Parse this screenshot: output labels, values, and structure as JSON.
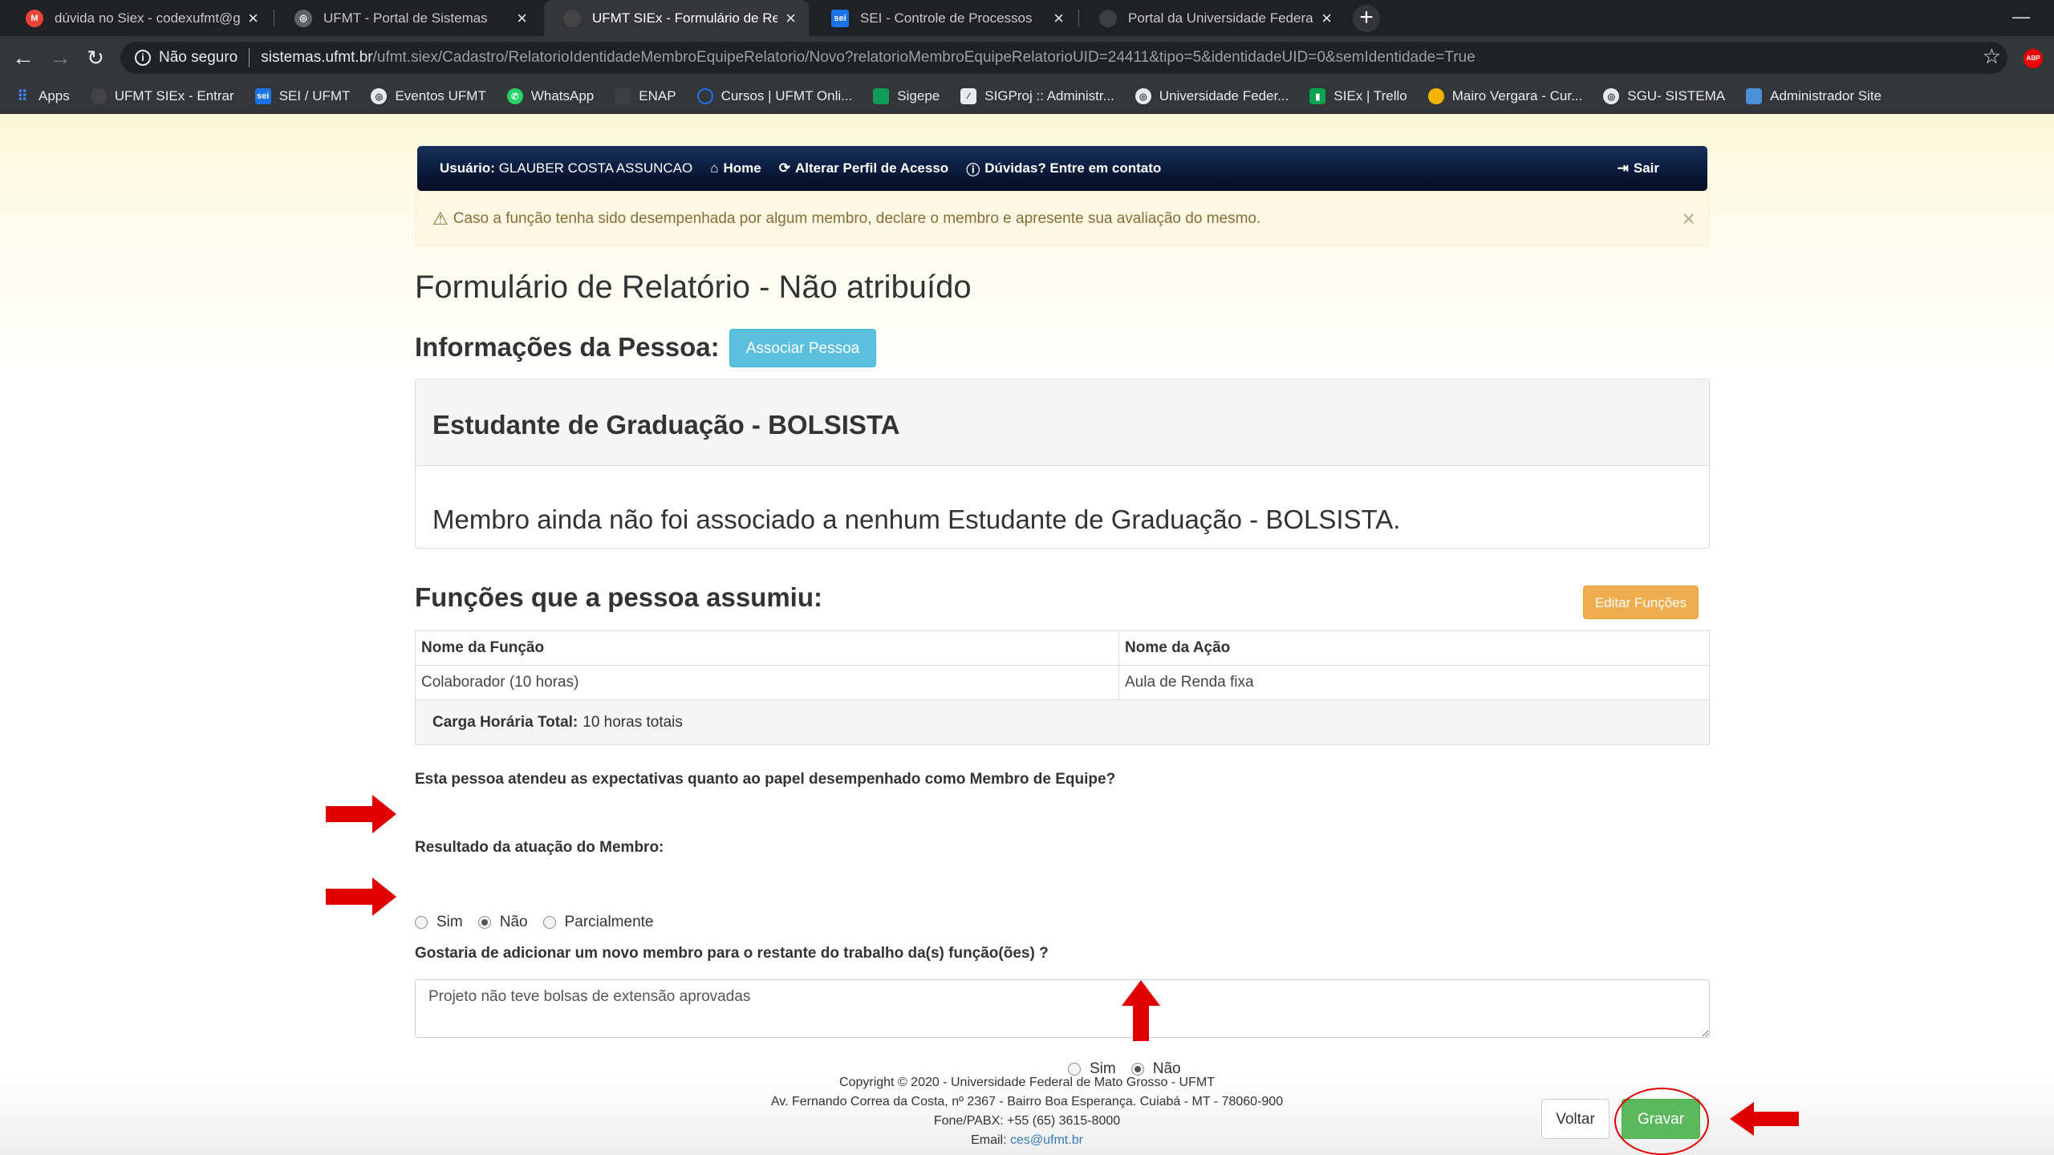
{
  "browser": {
    "tabs": [
      {
        "title": "dúvida no Siex - codexufmt@gm",
        "icon": "gmail-icon",
        "fav_color": "#ea4335",
        "fav_text": "M"
      },
      {
        "title": "UFMT - Portal de Sistemas",
        "icon": "globe-icon",
        "fav_color": "#5f6368",
        "fav_text": "◎"
      },
      {
        "title": "UFMT SIEx - Formulário de Relató",
        "icon": "siex-icon",
        "fav_color": "#444",
        "fav_text": ""
      },
      {
        "title": "SEI - Controle de Processos",
        "icon": "sei-icon",
        "fav_color": "#1a73e8",
        "fav_text": "sei"
      },
      {
        "title": "Portal da Universidade Federal de",
        "icon": "ufmt-icon",
        "fav_color": "#3c4043",
        "fav_text": ""
      }
    ],
    "address": {
      "security_label": "Não seguro",
      "host": "sistemas.ufmt.br",
      "path": "/ufmt.siex/Cadastro/RelatorioIdentidadeMembroEquipeRelatorio/Novo?relatorioMembroEquipeRelatorioUID=24411&tipo=5&identidadeUID=0&semIdentidade=True"
    },
    "bookmarks": [
      {
        "label": "Apps",
        "icon": "apps-grid-icon",
        "color": "#4285f4"
      },
      {
        "label": "UFMT SIEx - Entrar",
        "icon": "siex-bookmark-icon",
        "color": "#444"
      },
      {
        "label": "SEI / UFMT",
        "icon": "sei-bookmark-icon",
        "color": "#1a73e8"
      },
      {
        "label": "Eventos UFMT",
        "icon": "globe-bookmark-icon",
        "color": "#5f6368"
      },
      {
        "label": "WhatsApp",
        "icon": "whatsapp-icon",
        "color": "#25d366"
      },
      {
        "label": "ENAP",
        "icon": "enap-icon",
        "color": "#3c4043"
      },
      {
        "label": "Cursos | UFMT Onli...",
        "icon": "moodle-icon",
        "color": "#1a73e8"
      },
      {
        "label": "Sigepe",
        "icon": "sigepe-icon",
        "color": "#0f9d58"
      },
      {
        "label": "SIGProj :: Administr...",
        "icon": "sigproj-icon",
        "color": "#5f6368"
      },
      {
        "label": "Universidade Feder...",
        "icon": "globe-bookmark-icon",
        "color": "#5f6368"
      },
      {
        "label": "SIEx | Trello",
        "icon": "trello-icon",
        "color": "#0aa34f"
      },
      {
        "label": "Mairo Vergara - Cur...",
        "icon": "course-icon",
        "color": "#f4b400"
      },
      {
        "label": "SGU- SISTEMA",
        "icon": "globe-bookmark-icon",
        "color": "#5f6368"
      },
      {
        "label": "Administrador Site",
        "icon": "admin-site-icon",
        "color": "#4a90d9"
      }
    ]
  },
  "userbar": {
    "user_prefix": "Usuário:",
    "user_name": "GLAUBER COSTA ASSUNCAO",
    "home": "Home",
    "change_profile": "Alterar Perfil de Acesso",
    "contact": "Dúvidas? Entre em contato",
    "logout": "Sair"
  },
  "alert": {
    "text": "Caso a função tenha sido desempenhada por algum membro, declare o membro e apresente sua avaliação do mesmo."
  },
  "form": {
    "title": "Formulário de Relatório - Não atribuído",
    "person_heading": "Informações da Pessoa:",
    "associate_button": "Associar Pessoa",
    "panel_title": "Estudante de Graduação - BOLSISTA",
    "panel_message": "Membro ainda não foi associado a nenhum Estudante de Graduação - BOLSISTA.",
    "functions_heading": "Funções que a pessoa assumiu:",
    "edit_functions_button": "Editar Funções",
    "table": {
      "headers": [
        "Nome da Função",
        "Nome da Ação"
      ],
      "rows": [
        [
          "Colaborador (10 horas)",
          "Aula de Renda fixa"
        ]
      ]
    },
    "total_label": "Carga Horária Total:",
    "total_value": "10 horas totais",
    "question1": "Esta pessoa atendeu as expectativas quanto ao papel desempenhado como Membro de Equipe?",
    "q1_options": [
      "Sim",
      "Não",
      "Parcialmente"
    ],
    "q1_selected": "Não",
    "result_label": "Resultado da atuação do Membro:",
    "result_value": "Projeto não teve bolsas de extensão aprovadas",
    "question2": "Gostaria de adicionar um novo membro para o restante do trabalho da(s) função(ões) ?",
    "q2_options": [
      "Sim",
      "Não"
    ],
    "q2_selected": "Não",
    "back_button": "Voltar",
    "save_button": "Gravar"
  },
  "footer": {
    "line1": "Copyright © 2020 - Universidade Federal de Mato Grosso - UFMT",
    "line2": "Av. Fernando Correa da Costa, nº 2367 - Bairro Boa Esperança. Cuiabá - MT - 78060-900",
    "line3": "Fone/PABX: +55 (65) 3615-8000",
    "email_label": "Email:",
    "email": "ces@ufmt.br"
  },
  "colors": {
    "annotation_red": "#e00000",
    "info_button": "#5bc0de",
    "warning_button": "#f0ad4e",
    "success_button": "#5cb85c"
  }
}
